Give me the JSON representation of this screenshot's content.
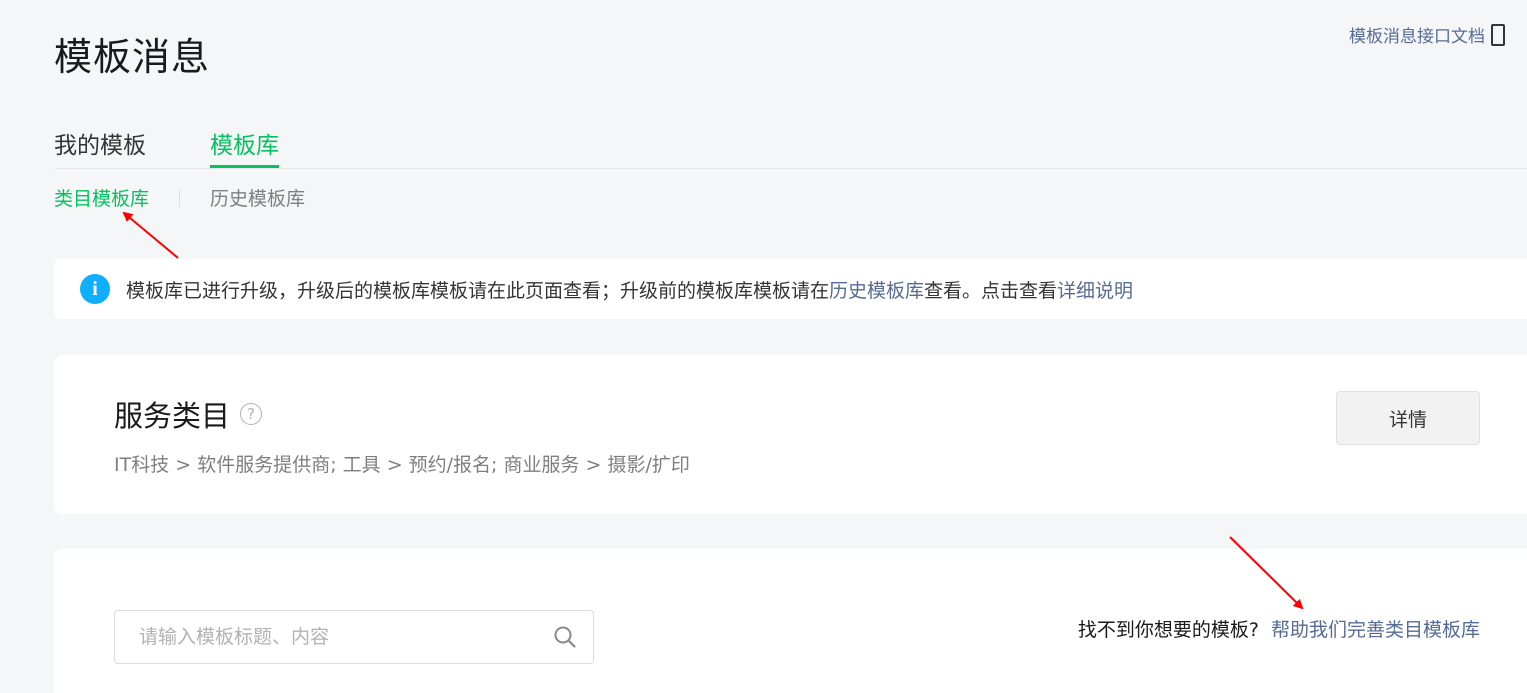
{
  "header": {
    "title": "模板消息",
    "doc_link": "模板消息接口文档"
  },
  "tabs": {
    "mine": "我的模板",
    "library": "模板库"
  },
  "sub_tabs": {
    "category": "类目模板库",
    "history": "历史模板库"
  },
  "notice": {
    "text_before": "模板库已进行升级，升级后的模板库模板请在此页面查看；升级前的模板库模板请在",
    "history_link": "历史模板库",
    "text_middle": "查看。点击查看",
    "detail_link": "详细说明"
  },
  "service": {
    "title": "服务类目",
    "help": "?",
    "path": "IT科技 > 软件服务提供商; 工具 > 预约/报名; 商业服务 > 摄影/扩印",
    "detail_button": "详情"
  },
  "search": {
    "placeholder": "请输入模板标题、内容",
    "value": ""
  },
  "feedback": {
    "question": "找不到你想要的模板?",
    "link": "帮助我们完善类目模板库"
  },
  "colors": {
    "brand_green": "#07c160",
    "link_blue": "#576b95",
    "info_blue": "#10aeff",
    "annotation_red": "#ff0000"
  }
}
